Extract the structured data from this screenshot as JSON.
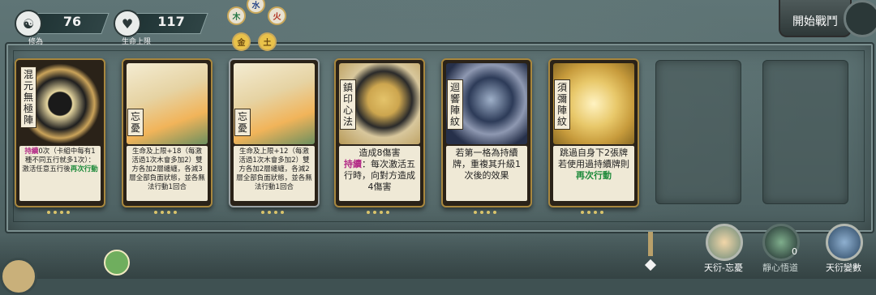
{
  "stats": [
    {
      "label": "修為",
      "value": "76",
      "icon": "meditation-icon"
    },
    {
      "label": "生命上限",
      "value": "117",
      "icon": "heart-drop-icon"
    }
  ],
  "elements": [
    "木",
    "水",
    "火",
    "金",
    "土"
  ],
  "start_button": "開始戰鬥",
  "cards": [
    {
      "name": "混元無極陣",
      "rarity": "gold",
      "text_parts": [
        [
          "持續",
          "mag"
        ],
        [
          "0次（卡組中每有1種不同五行就多1次）：激活任意五行後",
          ""
        ],
        [
          "再次行動",
          "grn"
        ]
      ],
      "big": false
    },
    {
      "name": "忘憂",
      "rarity": "gold",
      "text_parts": [
        [
          "生命及上限+18（每激活過1次木會多加2）雙方各加2層纏纏，各減3層全部負面狀態，並各無法行動1回合",
          ""
        ]
      ],
      "big": false
    },
    {
      "name": "忘憂",
      "rarity": "silver",
      "text_parts": [
        [
          "生命及上限+12（每激活過1次木會多加2）雙方各加2層纏纏，各減2層全部負面狀態，並各無法行動1回合",
          ""
        ]
      ],
      "big": false
    },
    {
      "name": "鎮印心法",
      "rarity": "gold",
      "text_parts": [
        [
          "造成8傷害",
          ""
        ],
        [
          "持續",
          "mag"
        ],
        [
          "：每次激活五行時，向對方造成4傷害",
          ""
        ]
      ],
      "big": true
    },
    {
      "name": "迴響陣紋",
      "rarity": "gold",
      "text_parts": [
        [
          "若第一格為持續牌，重複其升級1次後的效果",
          ""
        ]
      ],
      "big": true
    },
    {
      "name": "須彌陣紋",
      "rarity": "gold",
      "text_parts": [
        [
          "跳過自身下2張牌 若使用過持續牌則",
          ""
        ],
        [
          "再次行動",
          "grn"
        ]
      ],
      "big": true
    }
  ],
  "empty_slots": 2,
  "bottom_buttons": [
    {
      "label": "天衍-忘憂",
      "icon": "portrait-icon",
      "count": ""
    },
    {
      "label": "靜心悟道",
      "icon": "lotus-icon",
      "count": "0"
    },
    {
      "label": "天衍變數",
      "icon": "cards-icon",
      "count": ""
    }
  ],
  "colors": {
    "persistent": "#b32a86",
    "reaction": "#1d8a3a",
    "frame": "#a8873e"
  }
}
